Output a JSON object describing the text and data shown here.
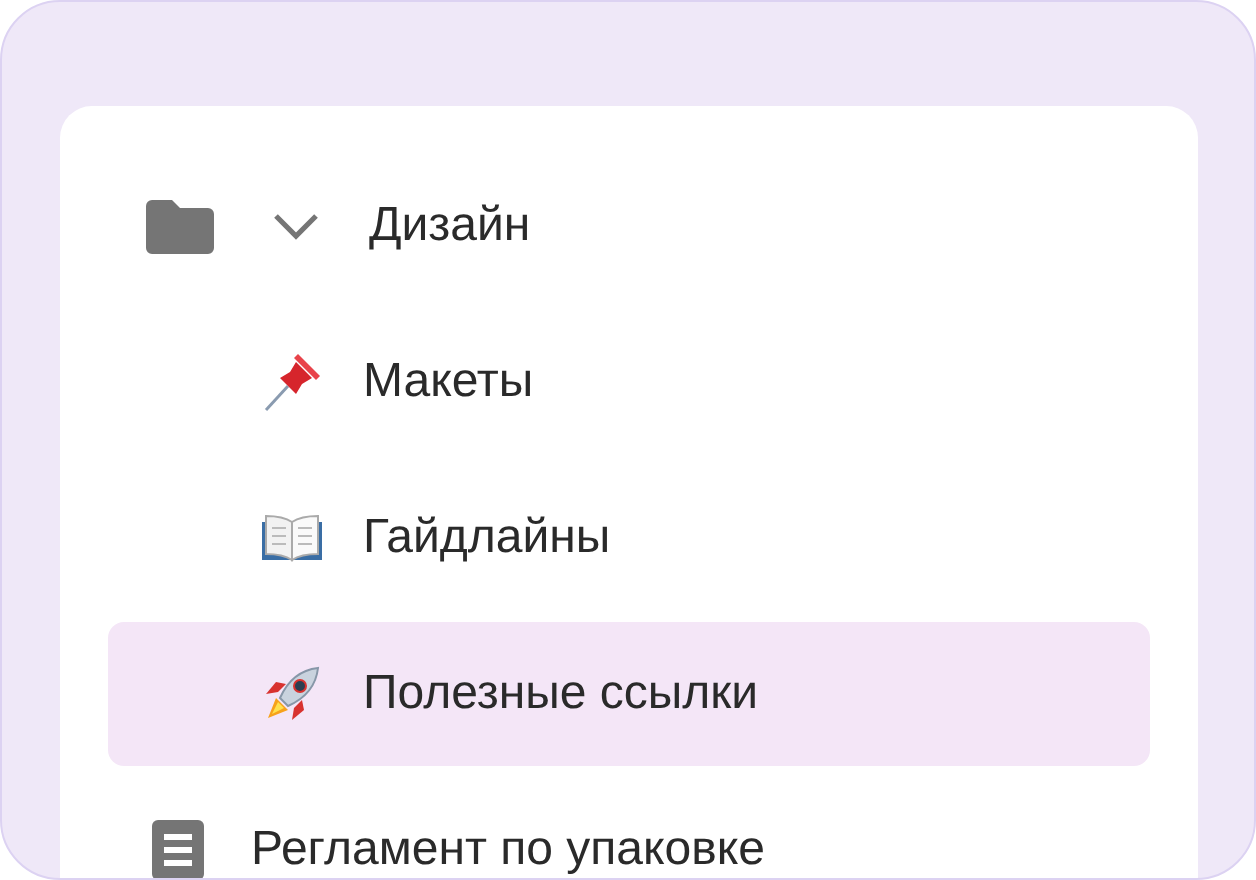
{
  "sidebar": {
    "items": [
      {
        "kind": "folder",
        "label": "Дизайн",
        "expanded": true,
        "selected": false,
        "children": [
          {
            "kind": "page",
            "label": "Макеты",
            "selected": false
          },
          {
            "kind": "page",
            "label": "Гайдлайны",
            "selected": false
          },
          {
            "kind": "page",
            "label": "Полезные ссылки",
            "selected": true
          }
        ]
      },
      {
        "kind": "document",
        "label": "Регламент по упаковке",
        "selected": false
      }
    ]
  }
}
